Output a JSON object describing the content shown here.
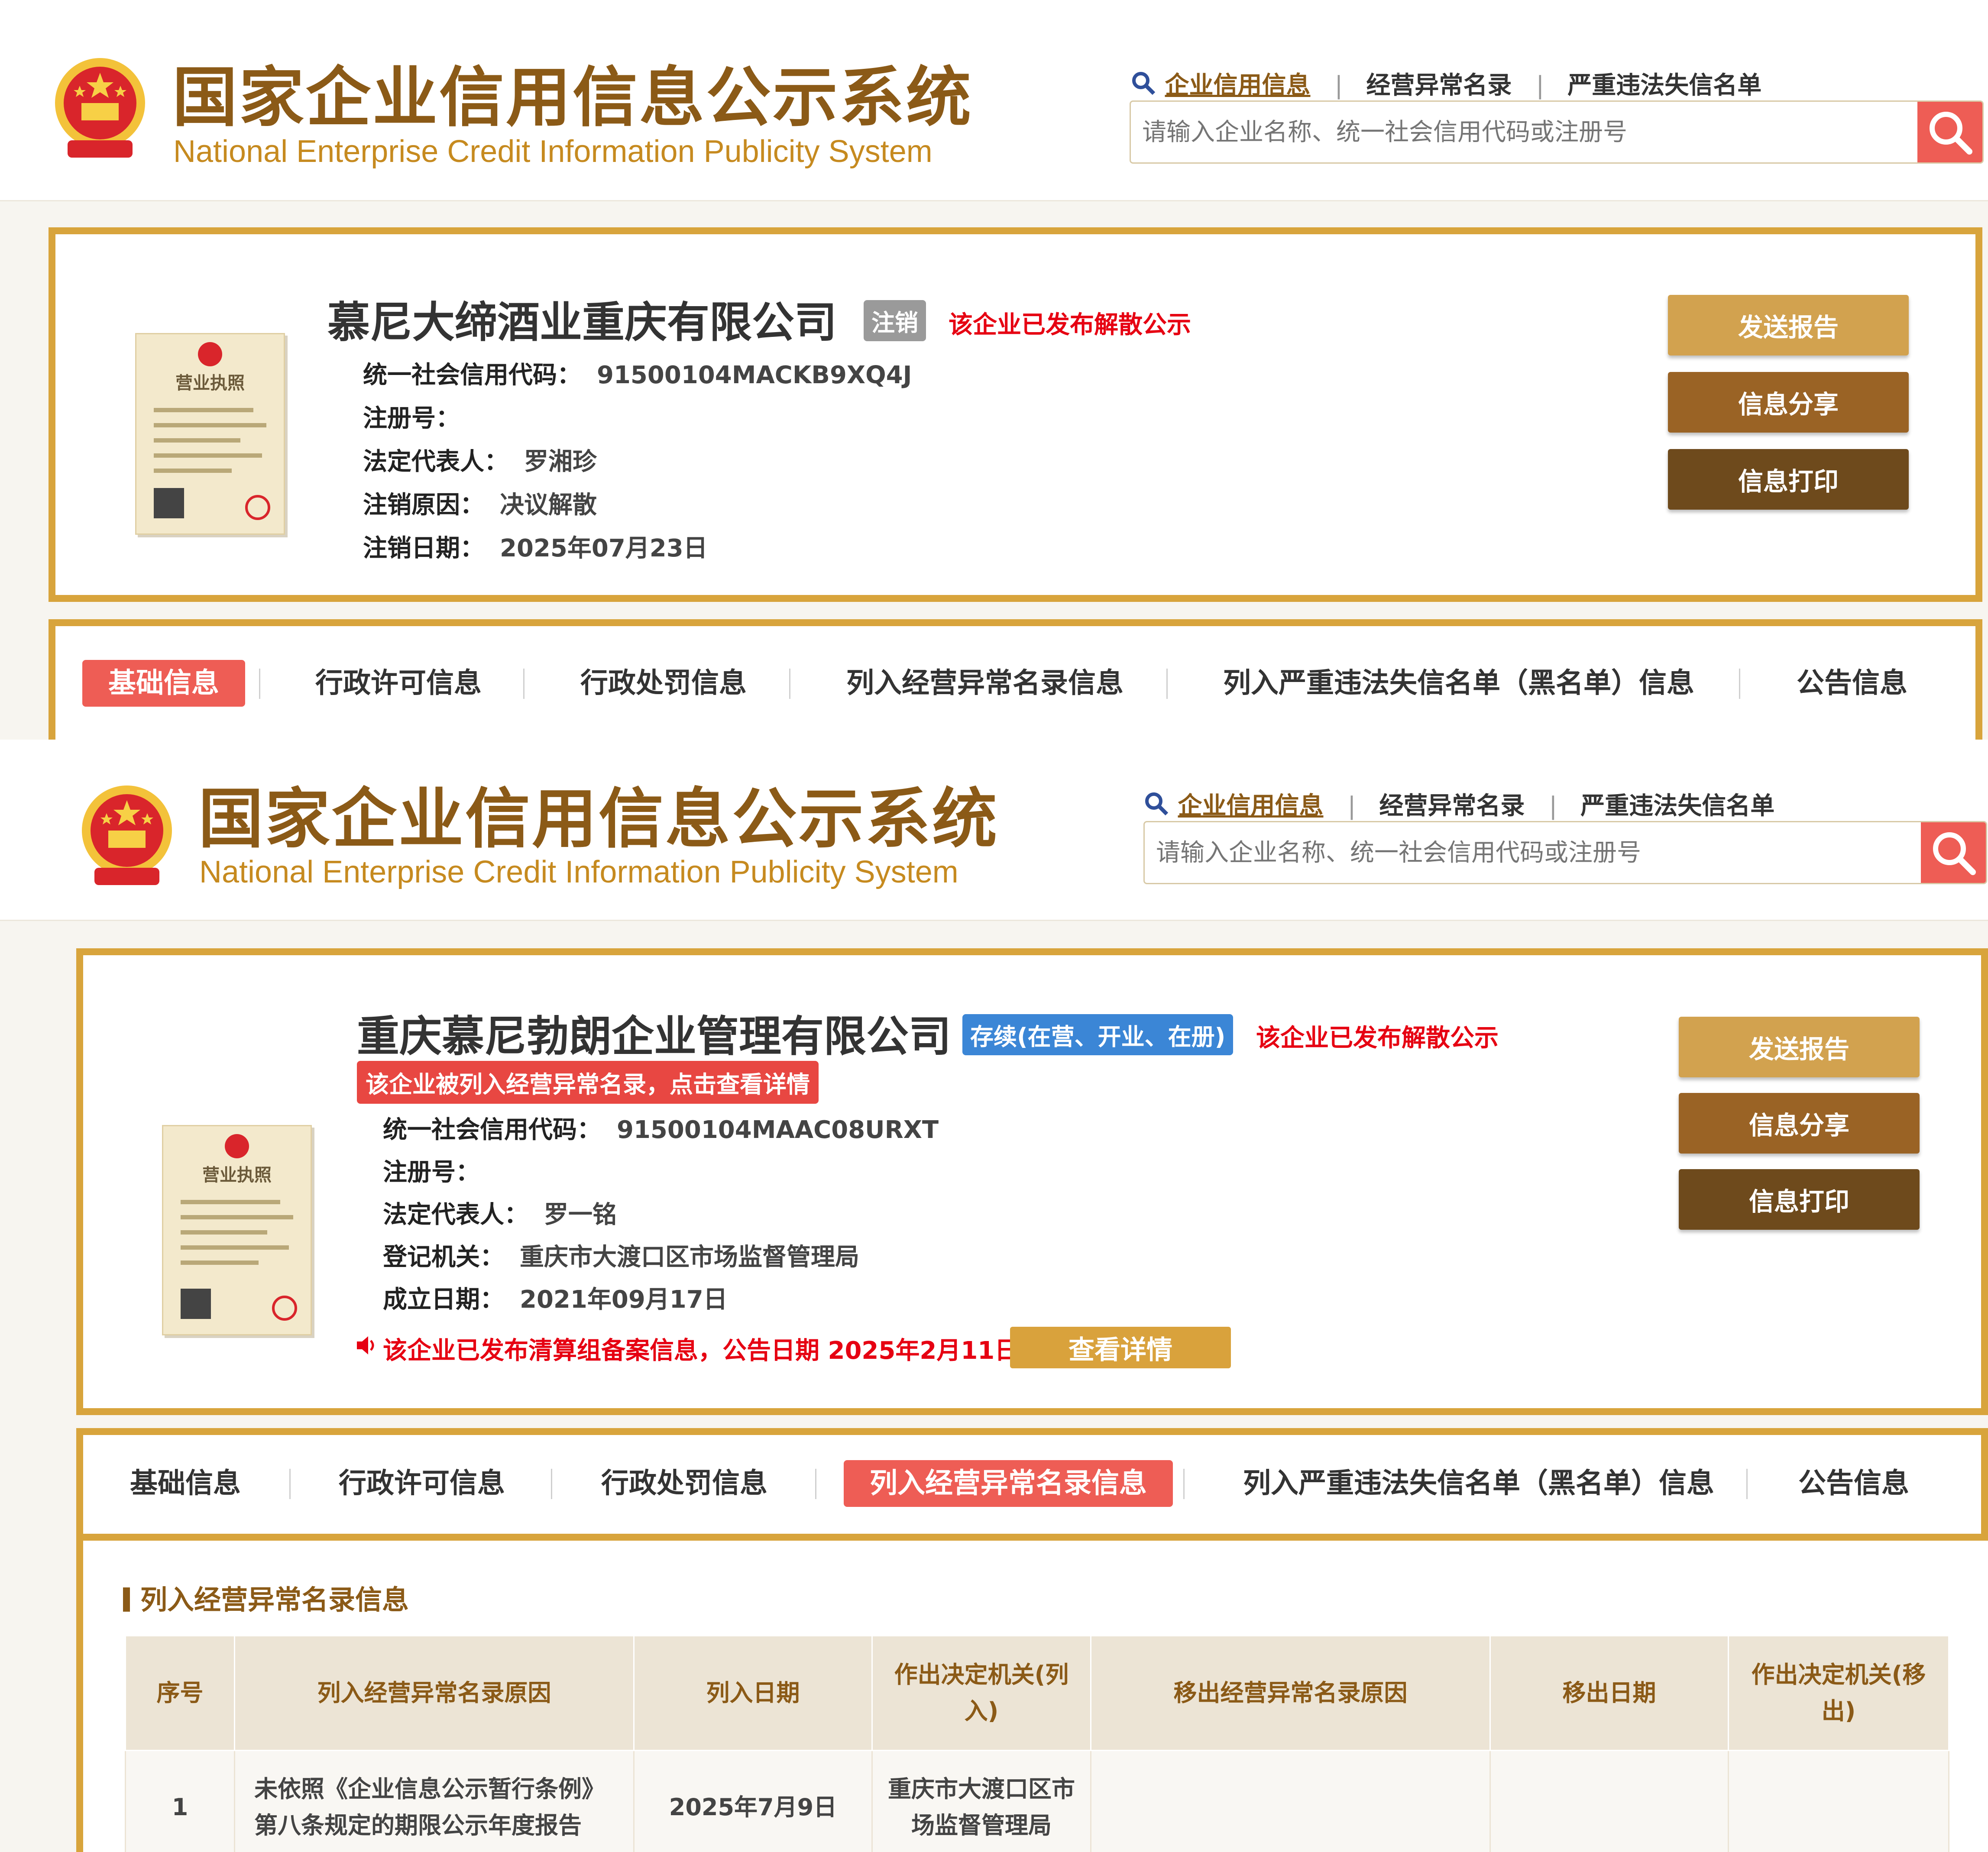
{
  "header": {
    "title_cn": "国家企业信用信息公示系统",
    "title_en": "National Enterprise Credit Information Publicity System",
    "nav": [
      "企业信用信息",
      "经营异常名录",
      "严重违法失信名单"
    ],
    "search_placeholder": "请输入企业名称、统一社会信用代码或注册号"
  },
  "company1": {
    "name": "慕尼大缔酒业重庆有限公司",
    "status_badge": "注销",
    "notice": "该企业已发布解散公示",
    "fields": [
      {
        "label": "统一社会信用代码：",
        "value": "91500104MACKB9XQ4J"
      },
      {
        "label": "注册号：",
        "value": ""
      },
      {
        "label": "法定代表人：",
        "value": "罗湘珍"
      },
      {
        "label": "注销原因：",
        "value": "决议解散"
      },
      {
        "label": "注销日期：",
        "value": "2025年07月23日"
      }
    ]
  },
  "company2": {
    "name": "重庆慕尼勃朗企业管理有限公司",
    "status_badge": "存续(在营、开业、在册)",
    "notice": "该企业已发布解散公示",
    "abnormal_banner": "该企业被列入经营异常名录，点击查看详情",
    "fields": [
      {
        "label": "统一社会信用代码：",
        "value": "91500104MAAC08URXT"
      },
      {
        "label": "注册号：",
        "value": ""
      },
      {
        "label": "法定代表人：",
        "value": "罗一铭"
      },
      {
        "label": "登记机关：",
        "value": "重庆市大渡口区市场监督管理局"
      },
      {
        "label": "成立日期：",
        "value": "2021年09月17日"
      }
    ],
    "liquidation_notice": "该企业已发布清算组备案信息，公告日期 2025年2月11日",
    "liquidation_button": "查看详情"
  },
  "license_label": "营业执照",
  "actions": [
    "发送报告",
    "信息分享",
    "信息打印"
  ],
  "tabs": [
    "基础信息",
    "行政许可信息",
    "行政处罚信息",
    "列入经营异常名录信息",
    "列入严重违法失信名单（黑名单）信息",
    "公告信息"
  ],
  "section": {
    "title": "列入经营异常名录信息",
    "table": {
      "headers": [
        "序号",
        "列入经营异常名录原因",
        "列入日期",
        "作出决定机关(列入)",
        "移出经营异常名录原因",
        "移出日期",
        "作出决定机关(移出)"
      ],
      "rows": [
        [
          "1",
          "未依照《企业信息公示暂行条例》第八条规定的期限公示年度报告",
          "2025年7月9日",
          "重庆市大渡口区市场监督管理局",
          "",
          "",
          ""
        ]
      ]
    }
  },
  "colors": {
    "brand_brown": "#8b5a17",
    "gold_border": "#d8a43c",
    "red_tab": "#ee5d55",
    "alert_red": "#e60012"
  },
  "icons": [
    "national-emblem-icon",
    "magnifier-icon",
    "search-icon",
    "speaker-icon",
    "license-icon"
  ]
}
